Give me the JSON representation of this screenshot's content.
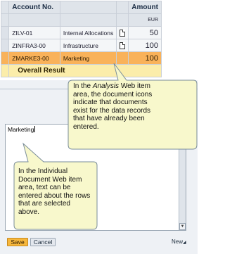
{
  "table": {
    "col_account_header": "Account No.",
    "col_amount_header": "Amount",
    "currency": "EUR",
    "rows": [
      {
        "account": "ZILV-01",
        "category": "Internal Allocations",
        "amount": "50"
      },
      {
        "account": "ZINFRA3-00",
        "category": "Infrastructure",
        "amount": "100"
      },
      {
        "account": "ZMARKE3-00",
        "category": "Marketing",
        "amount": "100"
      }
    ],
    "total_label": "Overall Result"
  },
  "editor": {
    "text": "Marketing"
  },
  "buttons": {
    "save": "Save",
    "cancel": "Cancel",
    "new": "New"
  },
  "callouts": {
    "analysis": {
      "line1": "In the",
      "italic": "Analysis",
      "line1b": "Web item",
      "lines": [
        "area, the document icons",
        "indicate that documents",
        "exist for the data records",
        "that have already been",
        "entered."
      ]
    },
    "document": {
      "lines": [
        "In the Individual",
        "Document Web item",
        "area, text can be",
        "entered about the rows",
        "that are selected",
        "above."
      ]
    }
  },
  "colors": {
    "highlight_row": "#f9b25a",
    "total_row": "#fbedaa",
    "callout_fill": "#f8f8cc",
    "save_button": "#f6b73c"
  }
}
